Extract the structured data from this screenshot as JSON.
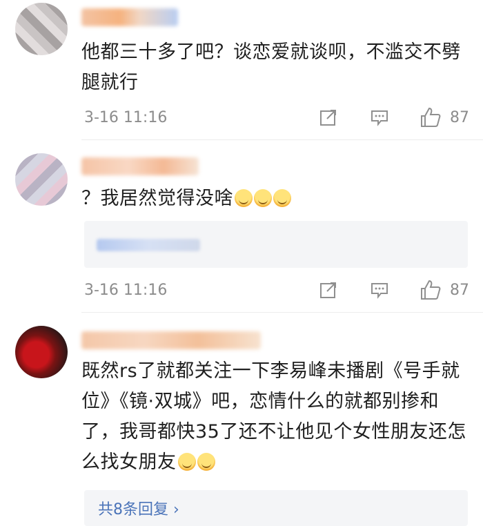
{
  "comments": [
    {
      "text": "他都三十多了吧？谈恋爱就谈呗，不滥交不劈腿就行",
      "time": "3-16 11:16",
      "likes": "87"
    },
    {
      "text": "？我居然觉得没啥",
      "emoji_count": 3,
      "time": "3-16 11:16",
      "likes": "87"
    },
    {
      "text": "既然rs了就都关注一下李易峰未播剧《号手就位》《镜·双城》吧，恋情什么的就都别掺和了，我哥都快35了还不让他见个女性朋友还怎么找女朋友",
      "emoji_count": 2,
      "reply_link": "共8条回复 ›"
    }
  ],
  "icons": {
    "share": "share-icon",
    "comment": "comment-icon",
    "like": "like-icon"
  },
  "colors": {
    "text": "#1f1f1f",
    "meta": "#8c8c8c",
    "link": "#4b74b9",
    "reply_bg": "#f4f5f7"
  }
}
